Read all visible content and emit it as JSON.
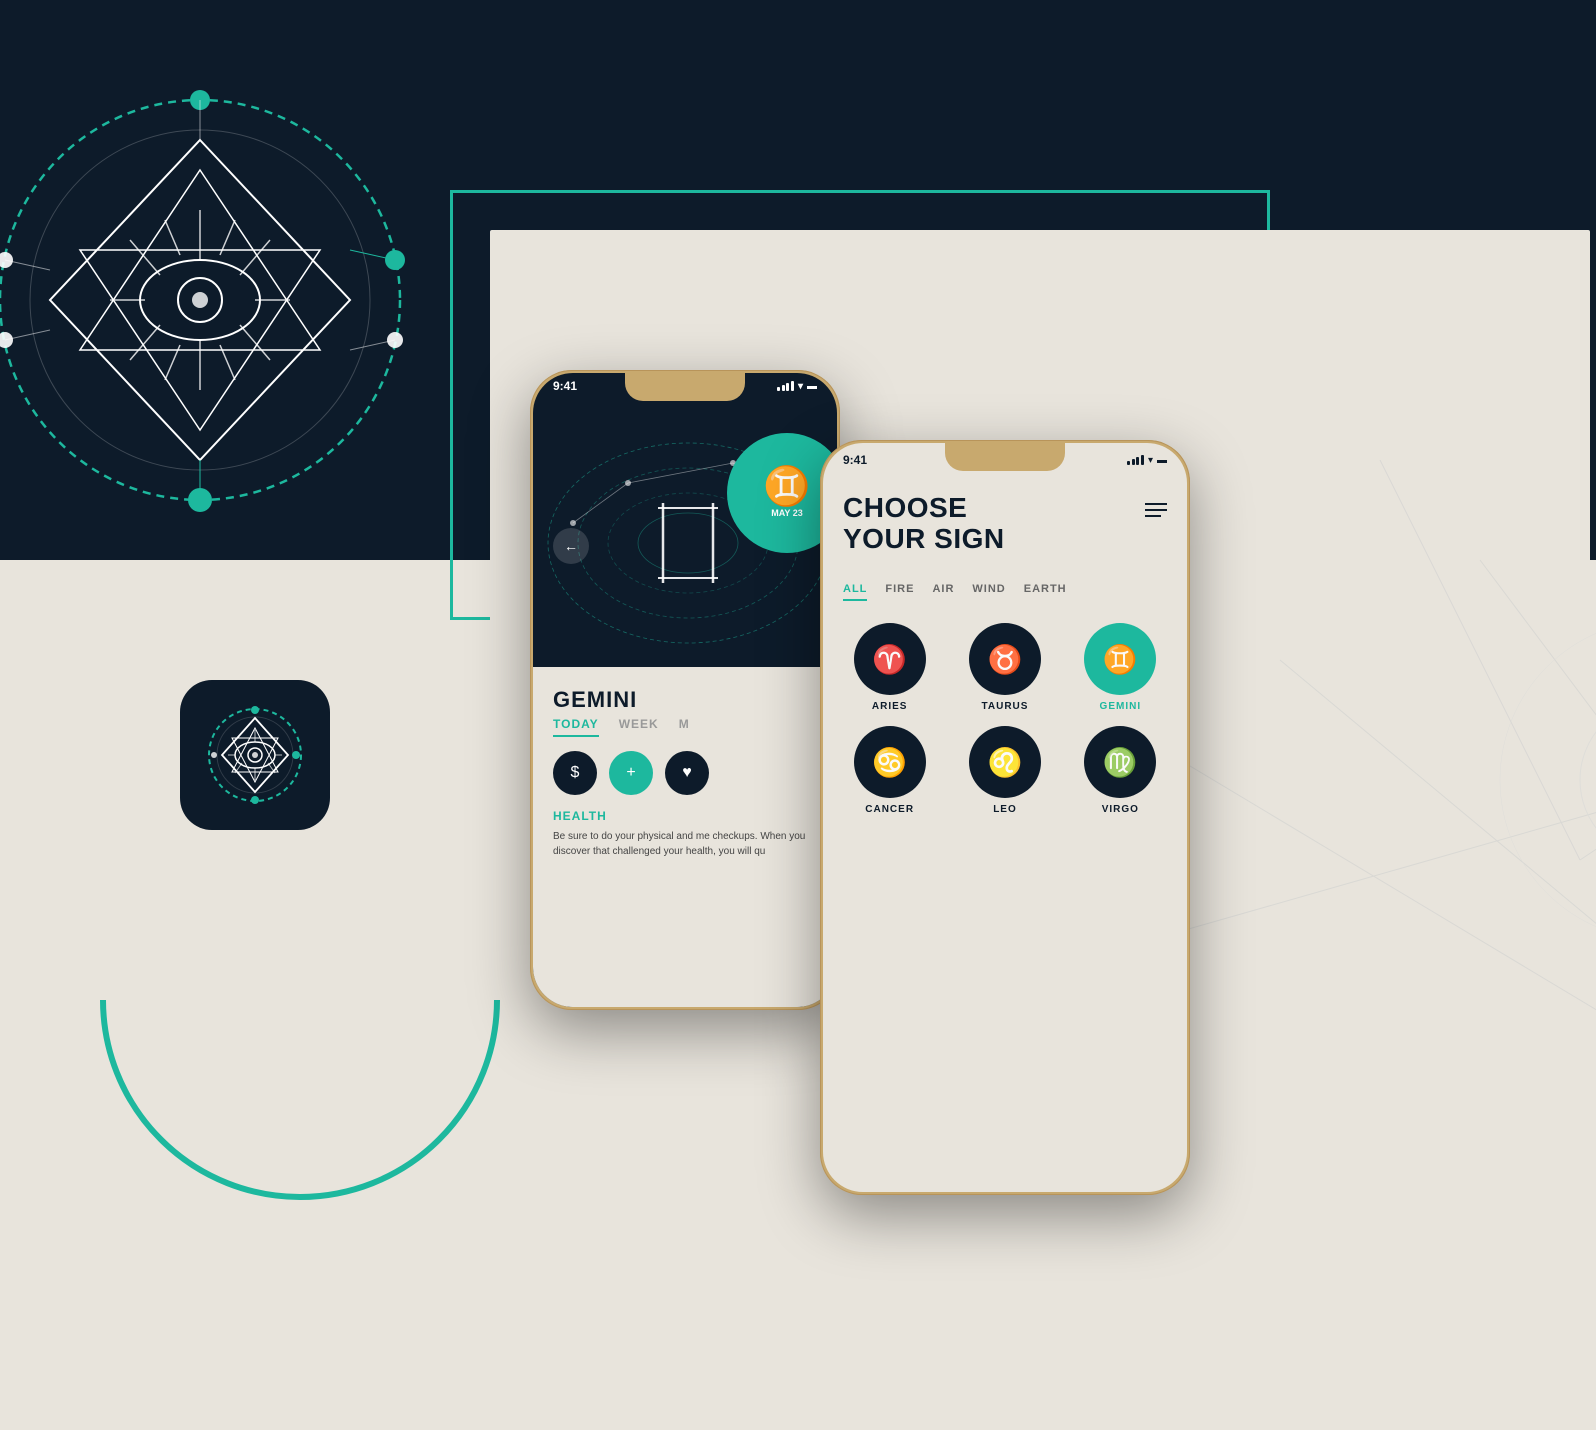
{
  "background": {
    "dark_color": "#0d1b2a",
    "light_color": "#e8e4dc",
    "teal_color": "#1db89e"
  },
  "back_phone": {
    "status_time": "9:41",
    "gemini_symbol": "♊",
    "gemini_date": "MAY 23",
    "back_button": "←",
    "sign_name": "GEMINI",
    "tabs": [
      {
        "label": "TODAY",
        "active": true
      },
      {
        "label": "WEEK",
        "active": false
      },
      {
        "label": "M",
        "active": false
      }
    ],
    "icons": [
      {
        "symbol": "$",
        "style": "money"
      },
      {
        "symbol": "+",
        "style": "health"
      },
      {
        "symbol": "♥",
        "style": "love"
      }
    ],
    "section_title": "HEALTH",
    "body_text": "Be sure to do your physical and me checkups. When you discover that challenged your health, you will qu"
  },
  "front_phone": {
    "status_time": "9:41",
    "title_line1": "CHOOSE",
    "title_line2": "YOUR SIGN",
    "filter_tabs": [
      {
        "label": "ALL",
        "active": true
      },
      {
        "label": "FIRE",
        "active": false
      },
      {
        "label": "AIR",
        "active": false
      },
      {
        "label": "WIND",
        "active": false
      },
      {
        "label": "EARTH",
        "active": false
      }
    ],
    "zodiac_signs": [
      {
        "name": "ARIES",
        "symbol": "♈",
        "active": false
      },
      {
        "name": "TAURUS",
        "symbol": "♉",
        "active": false
      },
      {
        "name": "GEMINI",
        "symbol": "♊",
        "active": true
      },
      {
        "name": "CANCER",
        "symbol": "♋",
        "active": false
      },
      {
        "name": "LEO",
        "symbol": "♌",
        "active": false
      },
      {
        "name": "VIRGO",
        "symbol": "♍",
        "active": false
      }
    ]
  },
  "app_icon": {
    "label": "Astrology App"
  }
}
